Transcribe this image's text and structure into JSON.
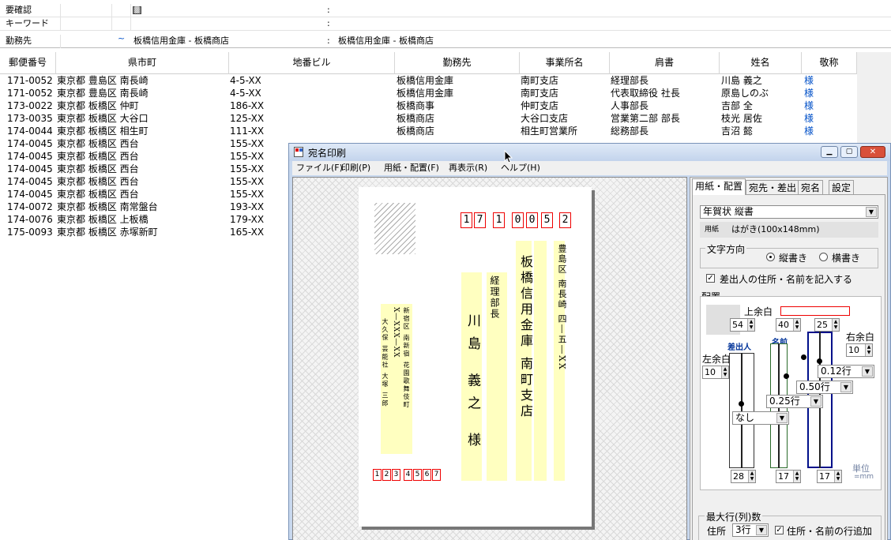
{
  "fields": [
    {
      "label": "要確認",
      "value": "",
      "value2": ""
    },
    {
      "label": "キーワード",
      "value": "",
      "value2": ""
    },
    {
      "label": "勤務先",
      "value": "板橋信用金庫 - 板橋商店",
      "value2": "板橋信用金庫 - 板橋商店"
    }
  ],
  "colon": ":",
  "tilde": "~",
  "columns": [
    "郵便番号",
    "県市町",
    "地番ビル",
    "勤務先",
    "事業所名",
    "肩書",
    "姓名",
    "敬称"
  ],
  "rows": [
    [
      "171-0052",
      "東京都 豊島区 南長崎",
      "4-5-XX",
      "板橋信用金庫",
      "南町支店",
      "経理部長",
      "川島 義之",
      "様"
    ],
    [
      "171-0052",
      "東京都 豊島区 南長崎",
      "4-5-XX",
      "板橋信用金庫",
      "南町支店",
      "代表取締役 社長",
      "原島しのぶ",
      "様"
    ],
    [
      "173-0022",
      "東京都 板橋区 仲町",
      "186-XX",
      "板橋商事",
      "仲町支店",
      "人事部長",
      "吉部 全",
      "様"
    ],
    [
      "173-0035",
      "東京都 板橋区 大谷口",
      "125-XX",
      "板橋商店",
      "大谷口支店",
      "営業第二部 部長",
      "枝光 居佐",
      "様"
    ],
    [
      "174-0044",
      "東京都 板橋区 相生町",
      "111-XX",
      "板橋商店",
      "相生町営業所",
      "総務部長",
      "吉沼 懿",
      "様"
    ],
    [
      "174-0045",
      "東京都 板橋区 西台",
      "155-XX",
      "",
      "",
      "",
      "",
      ""
    ],
    [
      "174-0045",
      "東京都 板橋区 西台",
      "155-XX",
      "",
      "",
      "",
      "",
      ""
    ],
    [
      "174-0045",
      "東京都 板橋区 西台",
      "155-XX",
      "",
      "",
      "",
      "",
      ""
    ],
    [
      "174-0045",
      "東京都 板橋区 西台",
      "155-XX",
      "",
      "",
      "",
      "",
      ""
    ],
    [
      "174-0045",
      "東京都 板橋区 西台",
      "155-XX",
      "",
      "",
      "",
      "",
      ""
    ],
    [
      "174-0072",
      "東京都 板橋区 南常盤台",
      "193-XX",
      "",
      "",
      "",
      "",
      ""
    ],
    [
      "174-0076",
      "東京都 板橋区 上板橋",
      "179-XX",
      "",
      "",
      "",
      "",
      ""
    ],
    [
      "175-0093",
      "東京都 板橋区 赤塚新町",
      "165-XX",
      "",
      "",
      "",
      "",
      ""
    ]
  ],
  "dialog": {
    "title": "宛名印刷",
    "menus": [
      "ファイル(F)",
      "印刷(P)",
      "用紙・配置(F)",
      "再表示(R)",
      "ヘルプ(H)"
    ],
    "card": {
      "zip": [
        "1",
        "7",
        "1",
        "0",
        "0",
        "5",
        "2"
      ],
      "sender_zip": [
        "1",
        "2",
        "3",
        "4",
        "5",
        "6",
        "7"
      ],
      "addr1": "豊島区 南長崎 四―五―XX",
      "company": "板橋信用金庫 南町支店",
      "title": "経理部長",
      "name": "川島 義之 様",
      "sender_addr": "新宿区 南新宿 花園歌舞伎町",
      "sender_num": "X―XXX―XX",
      "sender_name": "大久保 芸能社 大塚 三郎"
    },
    "tabs": [
      "用紙・配置",
      "宛先・差出",
      "宛名",
      "設定"
    ],
    "paper_select": "年賀状 縦書",
    "paper_label": "用紙",
    "paper_value": "はがき(100x148mm)",
    "direction_label": "文字方向",
    "direction_options": [
      "縦書き",
      "横書き"
    ],
    "sender_check_label": "差出人の住所・名前を記入する",
    "layout_label": "配置",
    "top_margin_label": "上余白",
    "right_margin_label": "右余白",
    "left_margin_label": "左余白",
    "spins": {
      "a": "54",
      "b": "40",
      "c": "25",
      "right": "10",
      "left": "10",
      "bottom1": "28",
      "bottom2": "17",
      "bottom3": "17"
    },
    "col_labels": [
      "差出人",
      "名前",
      "住所"
    ],
    "line_selects": [
      "0.12行",
      "0.50行",
      "0.25行"
    ],
    "none_select": "なし",
    "unit_label": "単位",
    "unit_value": "=mm",
    "maxrow_label": "最大行(列)数",
    "address_label": "住所",
    "address_rows": "3行",
    "add_lines_label": "住所・名前の行追加"
  }
}
